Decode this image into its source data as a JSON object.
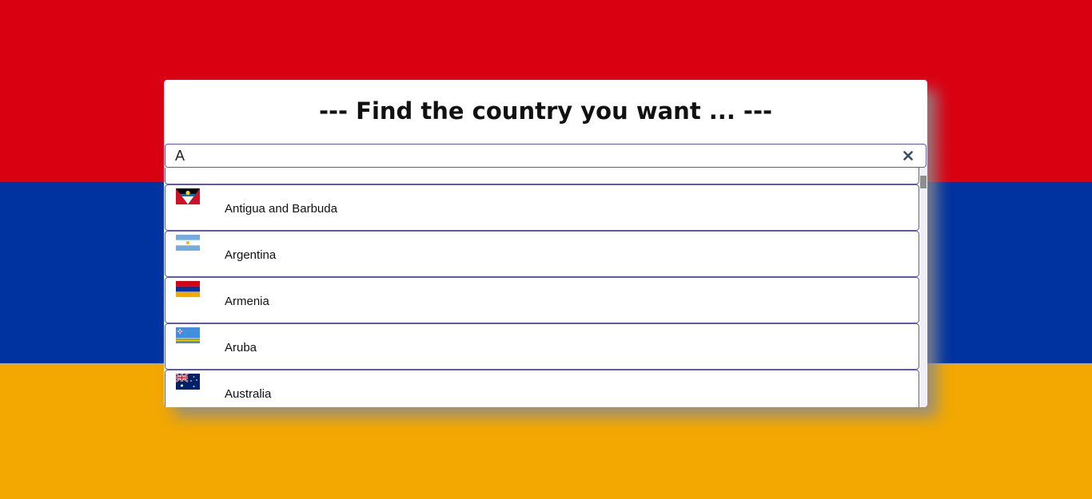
{
  "background": {
    "flag": "Armenia",
    "colors": [
      "#d90012",
      "#0033a0",
      "#f2a800"
    ]
  },
  "panel": {
    "title": "--- Find the country you want ... ---"
  },
  "search": {
    "value": "A",
    "clear_icon": "close-icon"
  },
  "results": [
    {
      "name": "Antigua and Barbuda",
      "flag_icon": "antigua-and-barbuda-flag-icon"
    },
    {
      "name": "Argentina",
      "flag_icon": "argentina-flag-icon"
    },
    {
      "name": "Armenia",
      "flag_icon": "armenia-flag-icon"
    },
    {
      "name": "Aruba",
      "flag_icon": "aruba-flag-icon"
    },
    {
      "name": "Australia",
      "flag_icon": "australia-flag-icon"
    }
  ],
  "colors": {
    "accent_border": "#5f59a6",
    "clear_icon": "#3b4a6b"
  }
}
